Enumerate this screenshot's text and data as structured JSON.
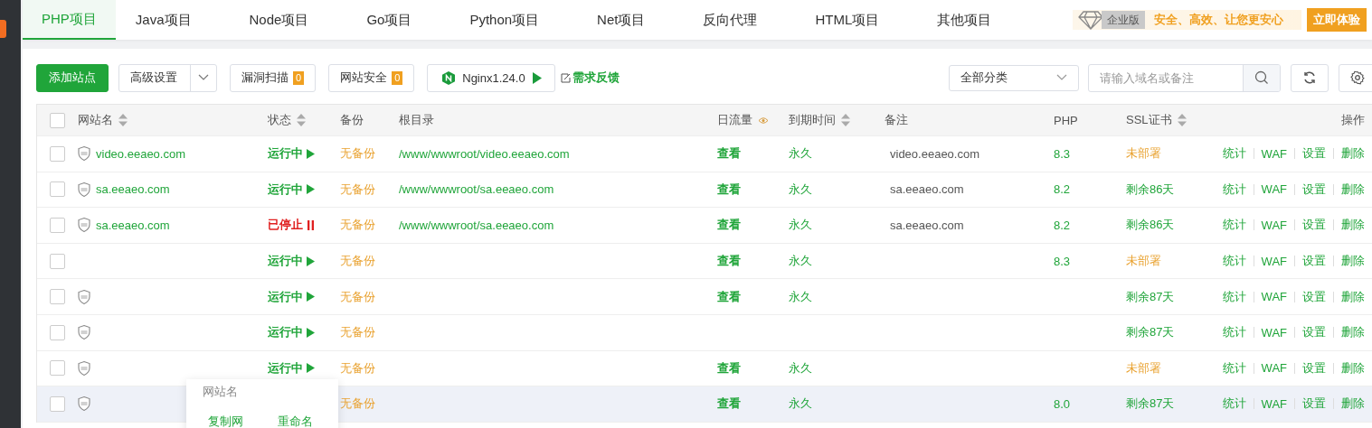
{
  "tabs": [
    {
      "label": "PHP项目",
      "selected": true
    },
    {
      "label": "Java项目",
      "selected": false
    },
    {
      "label": "Node项目",
      "selected": false
    },
    {
      "label": "Go项目",
      "selected": false
    },
    {
      "label": "Python项目",
      "selected": false
    },
    {
      "label": "Net项目",
      "selected": false
    },
    {
      "label": "反向代理",
      "selected": false
    },
    {
      "label": "HTML项目",
      "selected": false
    },
    {
      "label": "其他项目",
      "selected": false
    }
  ],
  "promo": {
    "tag": "企业版",
    "slogan": "安全、高效、让您更安心",
    "button": "立即体验"
  },
  "toolbar": {
    "add": "添加站点",
    "advanced": "高级设置",
    "scan": {
      "label": "漏洞扫描",
      "count": "0"
    },
    "security": {
      "label": "网站安全",
      "count": "0"
    },
    "nginx": "Nginx1.24.0",
    "feedback": "需求反馈",
    "category": "全部分类",
    "search_placeholder": "请输入域名或备注"
  },
  "select_all_checked": false,
  "columns": [
    {
      "label": "网站名",
      "sortable": true
    },
    {
      "label": "状态",
      "sortable": true
    },
    {
      "label": "备份",
      "sortable": false
    },
    {
      "label": "根目录",
      "sortable": false
    },
    {
      "label": "日流量",
      "sortable": false
    },
    {
      "label": "到期时间",
      "sortable": true
    },
    {
      "label": "备注",
      "sortable": false
    },
    {
      "label": "PHP",
      "sortable": false
    },
    {
      "label": "SSL证书",
      "sortable": true
    },
    {
      "label": "操作",
      "sortable": false
    }
  ],
  "rows": [
    {
      "checked": false,
      "name": "video.eeaeo.com",
      "waf": true,
      "status": {
        "label": "运行中",
        "running": true
      },
      "backup": "无备份",
      "root": "/www/wwwroot/video.eeaeo.com",
      "traffic": "查看",
      "expiry": "永久",
      "remark": "video.eeaeo.com",
      "php": "8.3",
      "ssl": {
        "label": "未部署",
        "deployed": false
      },
      "actions": [
        "统计",
        "WAF",
        "设置",
        "删除"
      ],
      "highlighted": false
    },
    {
      "checked": false,
      "name": "sa.eeaeo.com",
      "waf": true,
      "status": {
        "label": "运行中",
        "running": true
      },
      "backup": "无备份",
      "root": "/www/wwwroot/sa.eeaeo.com",
      "traffic": "查看",
      "expiry": "永久",
      "remark": "sa.eeaeo.com",
      "php": "8.2",
      "ssl": {
        "label": "剩余86天",
        "deployed": true
      },
      "actions": [
        "统计",
        "WAF",
        "设置",
        "删除"
      ],
      "highlighted": false
    },
    {
      "checked": false,
      "name": "sa.eeaeo.com",
      "waf": true,
      "status": {
        "label": "已停止",
        "running": false
      },
      "backup": "无备份",
      "root": "/www/wwwroot/sa.eeaeo.com",
      "traffic": "查看",
      "expiry": "永久",
      "remark": "sa.eeaeo.com",
      "php": "8.2",
      "ssl": {
        "label": "剩余86天",
        "deployed": true
      },
      "actions": [
        "统计",
        "WAF",
        "设置",
        "删除"
      ],
      "highlighted": false
    },
    {
      "checked": false,
      "waf": false,
      "status": {
        "label": "运行中",
        "running": true
      },
      "backup": "无备份",
      "traffic": "查看",
      "expiry": "永久",
      "php": "8.3",
      "ssl": {
        "label": "未部署",
        "deployed": false
      },
      "actions": [
        "统计",
        "WAF",
        "设置",
        "删除"
      ],
      "highlighted": false
    },
    {
      "checked": false,
      "waf": true,
      "status": {
        "label": "运行中",
        "running": true
      },
      "backup": "无备份",
      "traffic": "查看",
      "expiry": "永久",
      "ssl": {
        "label": "剩余87天",
        "deployed": true
      },
      "actions": [
        "统计",
        "WAF",
        "设置",
        "删除"
      ],
      "highlighted": false
    },
    {
      "checked": false,
      "waf": true,
      "status": {
        "label": "运行中",
        "running": true
      },
      "backup": "无备份",
      "ssl": {
        "label": "剩余87天",
        "deployed": true
      },
      "actions": [
        "统计",
        "WAF",
        "设置",
        "删除"
      ],
      "highlighted": false
    },
    {
      "checked": false,
      "waf": true,
      "status": {
        "label": "运行中",
        "running": true
      },
      "backup": "无备份",
      "traffic": "查看",
      "expiry": "永久",
      "ssl": {
        "label": "未部署",
        "deployed": false
      },
      "actions": [
        "统计",
        "WAF",
        "设置",
        "删除"
      ],
      "highlighted": false
    },
    {
      "checked": false,
      "waf": true,
      "backup": "无备份",
      "traffic": "查看",
      "expiry": "永久",
      "php": "8.0",
      "ssl": {
        "label": "剩余87天",
        "deployed": true
      },
      "actions": [
        "统计",
        "WAF",
        "设置",
        "删除"
      ],
      "highlighted": true
    }
  ],
  "context_menu": {
    "title": "网站名",
    "items": [
      "复制网",
      "重命名"
    ]
  }
}
